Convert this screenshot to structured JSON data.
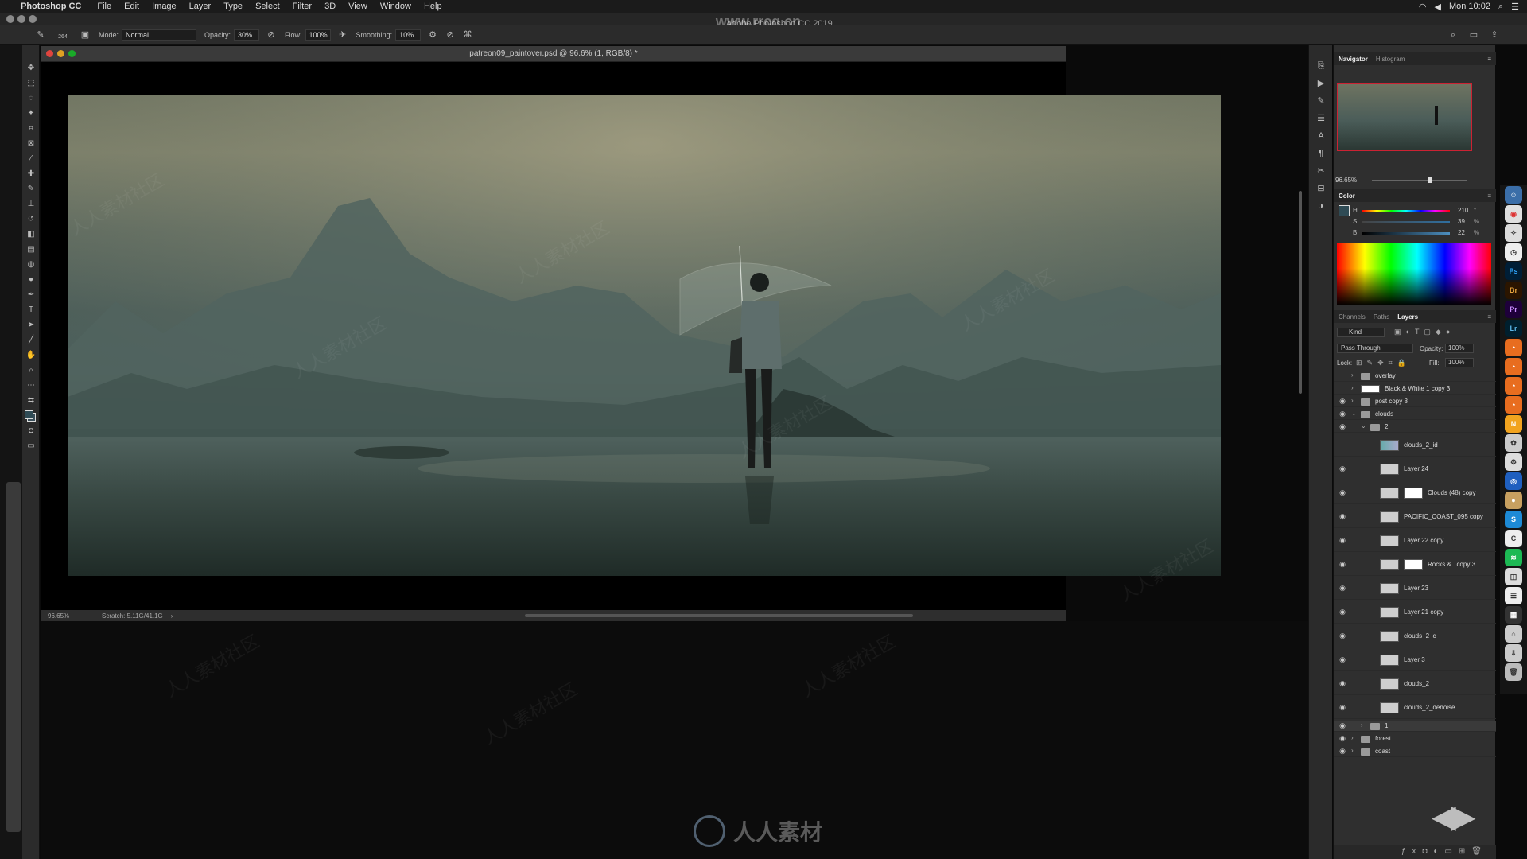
{
  "menubar": {
    "app_name": "Photoshop CC",
    "items": [
      "File",
      "Edit",
      "Image",
      "Layer",
      "Type",
      "Select",
      "Filter",
      "3D",
      "View",
      "Window",
      "Help"
    ],
    "clock": "Mon 10:02"
  },
  "window": {
    "title": "Adobe Photoshop CC 2019",
    "watermark_url": "www.rrcg.cn"
  },
  "options_bar": {
    "brush_size": "264",
    "mode_label": "Mode:",
    "mode_value": "Normal",
    "opacity_label": "Opacity:",
    "opacity_value": "30%",
    "flow_label": "Flow:",
    "flow_value": "100%",
    "smoothing_label": "Smoothing:",
    "smoothing_value": "10%"
  },
  "document": {
    "tab_title": "patreon09_paintover.psd @ 96.6% (1, RGB/8) *",
    "zoom": "96.65%",
    "scratch": "Scratch: 5.11G/41.1G"
  },
  "navigator": {
    "tabs": [
      "Navigator",
      "Histogram"
    ],
    "zoom": "96.65%"
  },
  "color_panel": {
    "title": "Color",
    "channels": [
      {
        "label": "H",
        "value": "210",
        "unit": "°"
      },
      {
        "label": "S",
        "value": "39",
        "unit": "%"
      },
      {
        "label": "B",
        "value": "22",
        "unit": "%"
      }
    ]
  },
  "layers_panel": {
    "tabs": [
      "Channels",
      "Paths",
      "Layers"
    ],
    "filter_kind": "Kind",
    "blend_mode": "Pass Through",
    "opacity_label": "Opacity:",
    "opacity_value": "100%",
    "lock_label": "Lock:",
    "fill_label": "Fill:",
    "fill_value": "100%",
    "layers": [
      {
        "name": "overlay",
        "type": "group",
        "visible": false,
        "indent": 0
      },
      {
        "name": "Black & White 1 copy 3",
        "type": "adjustment",
        "visible": false,
        "indent": 0
      },
      {
        "name": "post copy 8",
        "type": "group",
        "visible": true,
        "indent": 0
      },
      {
        "name": "clouds",
        "type": "group",
        "visible": true,
        "indent": 0
      },
      {
        "name": "2",
        "type": "group",
        "visible": true,
        "indent": 1
      },
      {
        "name": "clouds_2_id",
        "type": "layer",
        "visible": false,
        "indent": 2
      },
      {
        "name": "Layer 24",
        "type": "layer",
        "visible": true,
        "indent": 2
      },
      {
        "name": "Clouds (48) copy",
        "type": "masked",
        "visible": true,
        "indent": 2
      },
      {
        "name": "PACIFIC_COAST_095 copy",
        "type": "layer",
        "visible": true,
        "indent": 2
      },
      {
        "name": "Layer 22 copy",
        "type": "layer",
        "visible": true,
        "indent": 2
      },
      {
        "name": "Rocks &...copy 3",
        "type": "masked",
        "visible": true,
        "indent": 2
      },
      {
        "name": "Layer 23",
        "type": "layer",
        "visible": true,
        "indent": 2
      },
      {
        "name": "Layer 21 copy",
        "type": "layer",
        "visible": true,
        "indent": 2
      },
      {
        "name": "clouds_2_c",
        "type": "layer",
        "visible": true,
        "indent": 2
      },
      {
        "name": "Layer 3",
        "type": "layer",
        "visible": true,
        "indent": 2
      },
      {
        "name": "clouds_2",
        "type": "layer",
        "visible": true,
        "indent": 2
      },
      {
        "name": "clouds_2_denoise",
        "type": "layer",
        "visible": true,
        "indent": 2
      },
      {
        "name": "1",
        "type": "group",
        "visible": true,
        "indent": 1
      },
      {
        "name": "forest",
        "type": "group",
        "visible": true,
        "indent": 0
      },
      {
        "name": "coast",
        "type": "group",
        "visible": true,
        "indent": 0
      }
    ]
  },
  "dock_apps": [
    "Ps",
    "Br",
    "Pr",
    "Lr",
    "S"
  ],
  "watermark_text": "人人素材",
  "colors": {
    "menubar_bg": "#1b1b1b",
    "panel_bg": "#2f2f2f",
    "toolbar_bg": "#2b2b2b",
    "canvas_bg": "#000000",
    "accent_ps": "#31a8ff"
  }
}
